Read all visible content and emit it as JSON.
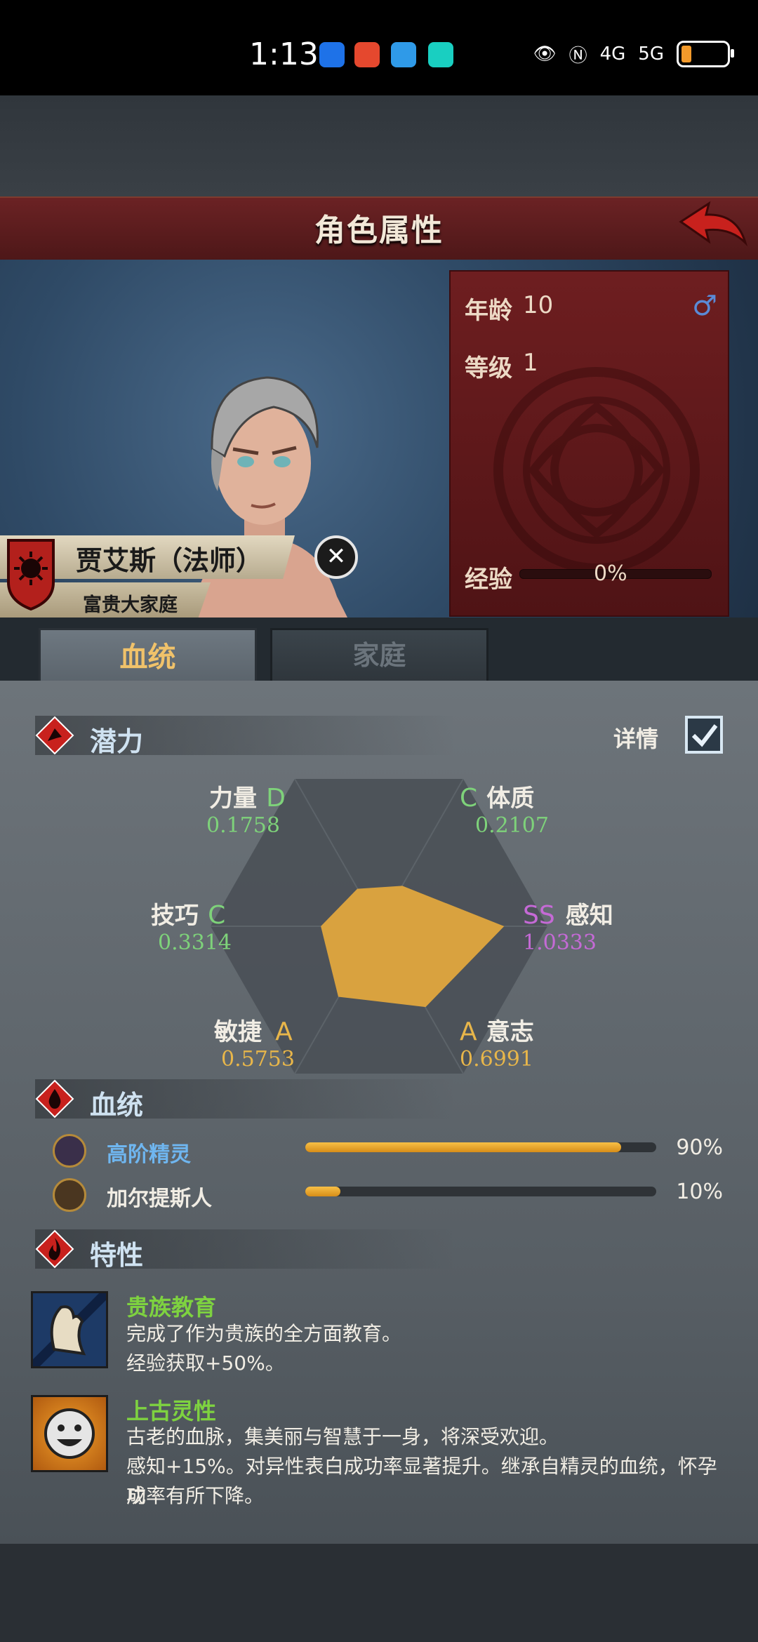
{
  "status": {
    "time": "1:13",
    "net1": "4G",
    "net2": "5G"
  },
  "header": {
    "title": "角色属性"
  },
  "character": {
    "age_label": "年龄",
    "age": "10",
    "level_label": "等级",
    "level": "1",
    "xp_label": "经验",
    "xp_pct": "0%",
    "xp_fraction": 0,
    "name": "贾艾斯（法师）",
    "family": "富贵大家庭",
    "gender": "♂",
    "close_glyph": "✕"
  },
  "tabs": [
    {
      "label": "血统"
    },
    {
      "label": "家庭"
    }
  ],
  "potential": {
    "title": "潜力",
    "detail_label": "详情",
    "detail_checked": true,
    "stats": [
      {
        "name": "力量",
        "grade": "D",
        "value": "0.1758",
        "grade_color": "#7ed27a"
      },
      {
        "name": "体质",
        "grade": "C",
        "value": "0.2107",
        "grade_color": "#7ed27a"
      },
      {
        "name": "感知",
        "grade": "SS",
        "value": "1.0333",
        "grade_color": "#c56ad6"
      },
      {
        "name": "意志",
        "grade": "A",
        "value": "0.6991",
        "grade_color": "#e8b64a"
      },
      {
        "name": "敏捷",
        "grade": "A",
        "value": "0.5753",
        "grade_color": "#e8b64a"
      },
      {
        "name": "技巧",
        "grade": "C",
        "value": "0.3314",
        "grade_color": "#7ed27a"
      }
    ]
  },
  "bloodline": {
    "title": "血统",
    "items": [
      {
        "name": "高阶精灵",
        "pct": "90%",
        "fraction": 0.9,
        "color": "#6fb6f0"
      },
      {
        "name": "加尔提斯人",
        "pct": "10%",
        "fraction": 0.1,
        "color": "#f1ede4"
      }
    ]
  },
  "traits": {
    "title": "特性",
    "items": [
      {
        "name": "贵族教育",
        "desc1": "完成了作为贵族的全方面教育。",
        "desc2": "经验获取+50%。"
      },
      {
        "name": "上古灵性",
        "desc1": "古老的血脉，集美丽与智慧于一身，将深受欢迎。",
        "desc2": "感知+15%。对异性表白成功率显著提升。继承自精灵的血统，怀孕成",
        "desc3": "功率有所下降。"
      }
    ]
  }
}
